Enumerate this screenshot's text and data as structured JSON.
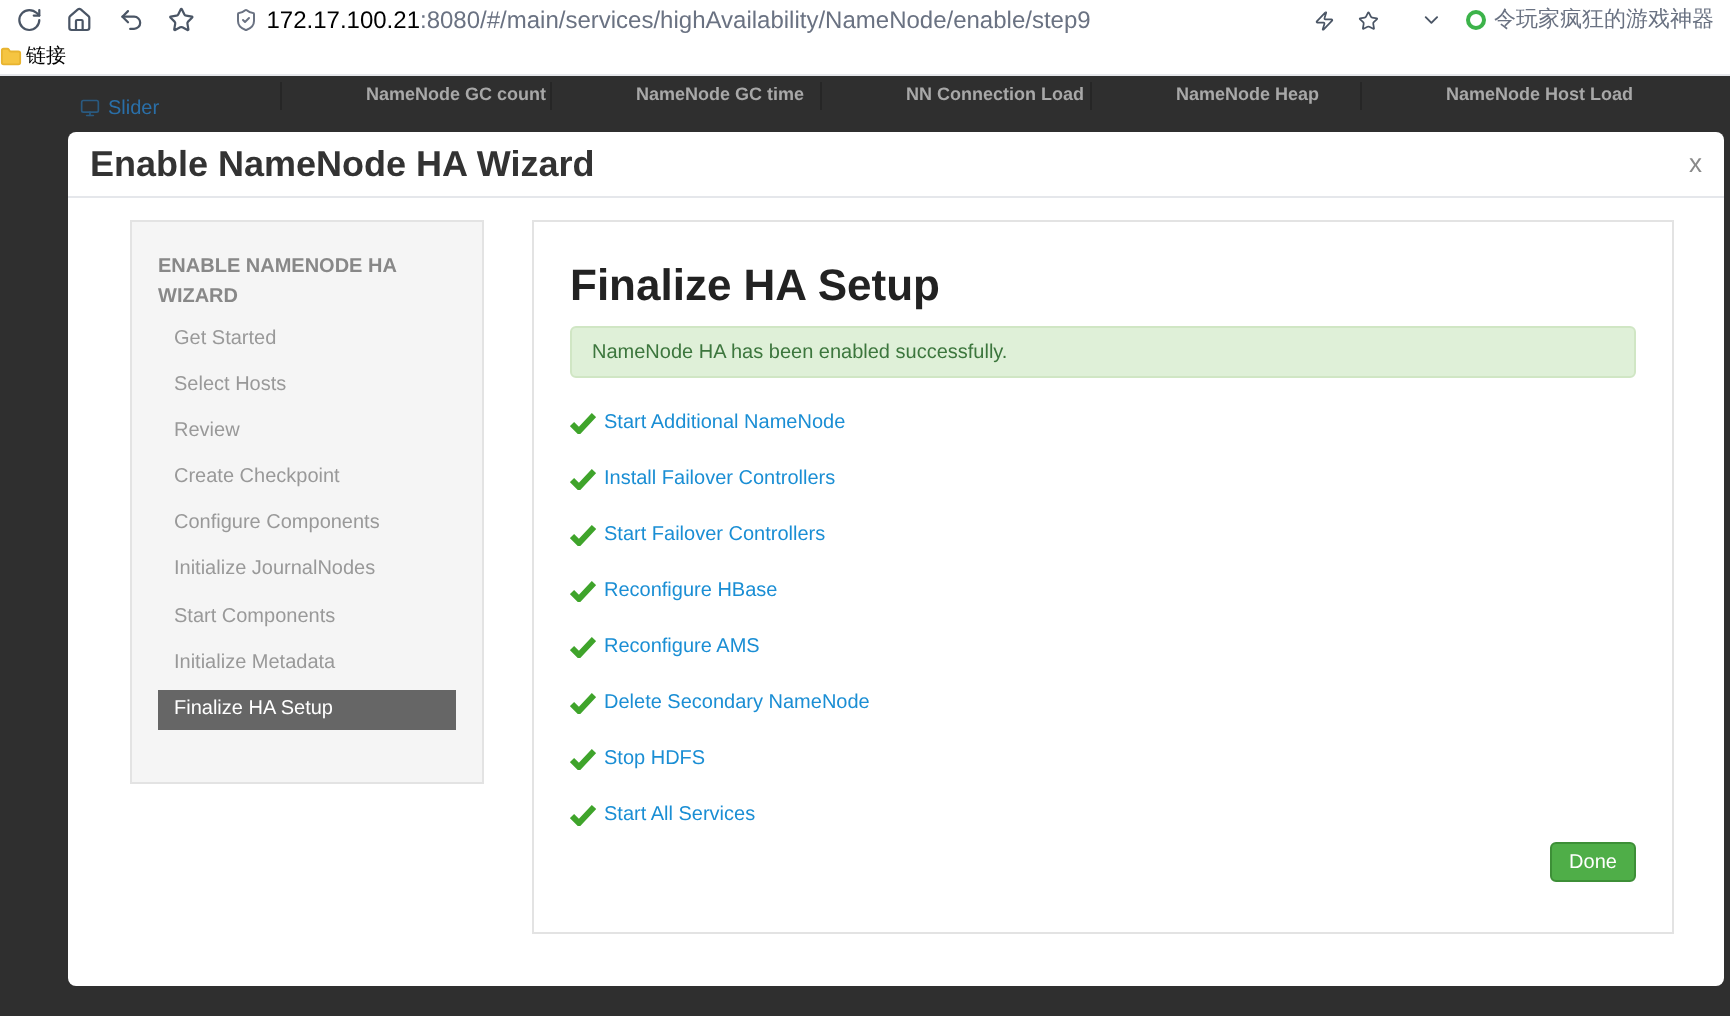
{
  "browser": {
    "url_host": "172.17.100.21",
    "url_rest": ":8080/#/main/services/highAvailability/NameNode/enable/step9",
    "search_hint": "令玩家疯狂的游戏神器",
    "bookmark": "链接"
  },
  "background": {
    "sidebar_item": "Slider",
    "columns": [
      "NameNode GC count",
      "NameNode GC time",
      "NN Connection Load",
      "NameNode Heap",
      "NameNode Host Load"
    ]
  },
  "modal": {
    "title": "Enable NameNode HA Wizard",
    "close": "x",
    "sidebar": {
      "heading": "ENABLE NAMENODE HA WIZARD",
      "steps": [
        {
          "label": "Get Started",
          "selected": false
        },
        {
          "label": "Select Hosts",
          "selected": false
        },
        {
          "label": "Review",
          "selected": false
        },
        {
          "label": "Create Checkpoint",
          "selected": false
        },
        {
          "label": "Configure Components",
          "selected": false
        },
        {
          "label": "Initialize JournalNodes",
          "selected": false
        },
        {
          "label": "Start Components",
          "selected": false
        },
        {
          "label": "Initialize Metadata",
          "selected": false
        },
        {
          "label": "Finalize HA Setup",
          "selected": true
        }
      ]
    },
    "content": {
      "heading": "Finalize HA Setup",
      "alert": "NameNode HA has been enabled successfully.",
      "tasks": [
        {
          "label": "Start Additional NameNode",
          "completed": true
        },
        {
          "label": "Install Failover Controllers",
          "completed": true
        },
        {
          "label": "Start Failover Controllers",
          "completed": true
        },
        {
          "label": "Reconfigure HBase",
          "completed": true
        },
        {
          "label": "Reconfigure AMS",
          "completed": true
        },
        {
          "label": "Delete Secondary NameNode",
          "completed": true
        },
        {
          "label": "Stop HDFS",
          "completed": true
        },
        {
          "label": "Start All Services",
          "completed": true
        }
      ],
      "button": "Done"
    }
  }
}
